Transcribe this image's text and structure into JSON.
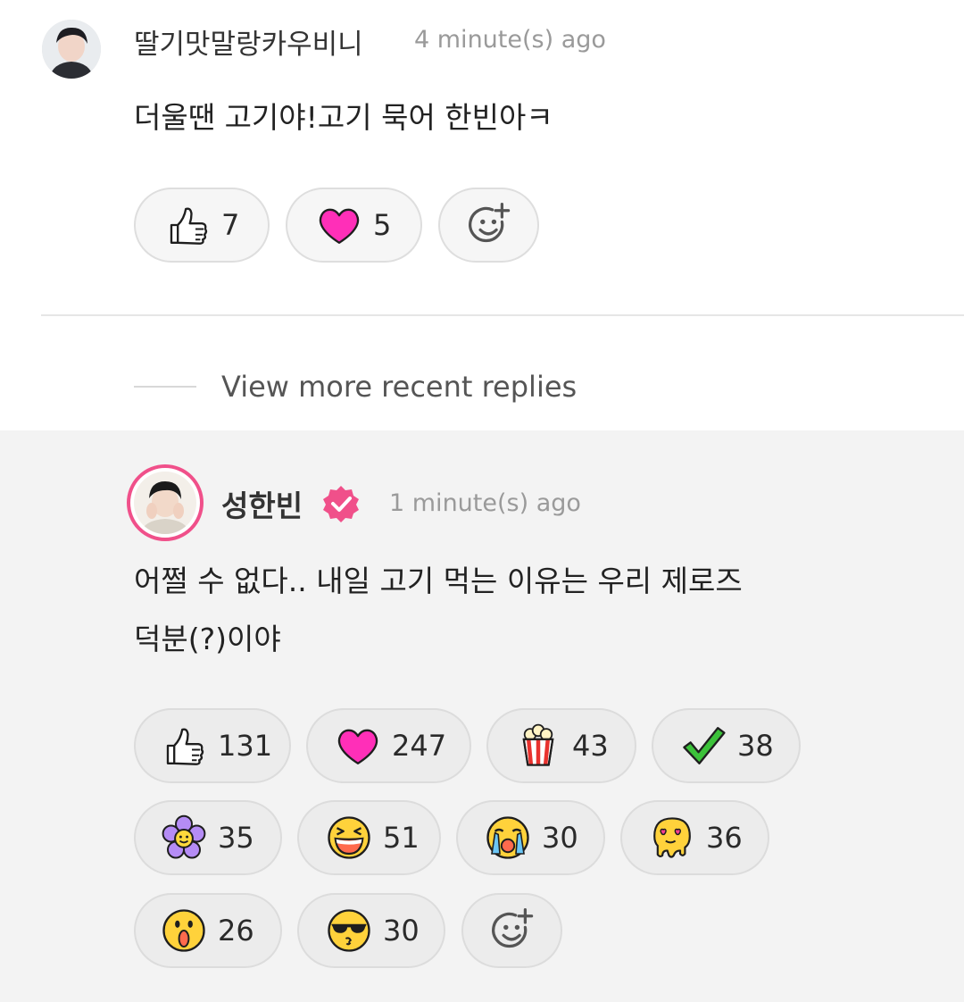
{
  "comment": {
    "username": "딸기맛말랑카우비니",
    "time": "4 minute(s) ago",
    "text": "더울땐 고기야!고기 묵어 한빈아ㅋ",
    "reactions": [
      {
        "icon": "thumbs-up-icon",
        "count": "7"
      },
      {
        "icon": "heart-icon",
        "count": "5"
      }
    ]
  },
  "thread": {
    "view_more_label": "View more recent replies"
  },
  "reply": {
    "username": "성한빈",
    "verified": true,
    "time": "1 minute(s) ago",
    "text_line1": "어쩔 수 없다.. 내일 고기 먹는 이유는 우리 제로즈",
    "text_line2": "덕분(?)이야",
    "reactions": [
      {
        "icon": "thumbs-up-icon",
        "count": "131"
      },
      {
        "icon": "heart-icon",
        "count": "247"
      },
      {
        "icon": "popcorn-icon",
        "count": "43"
      },
      {
        "icon": "checkmark-icon",
        "count": "38"
      },
      {
        "icon": "flower-icon",
        "count": "35"
      },
      {
        "icon": "laughing-face-icon",
        "count": "51"
      },
      {
        "icon": "crying-face-icon",
        "count": "30"
      },
      {
        "icon": "melting-heart-eyes-icon",
        "count": "36"
      },
      {
        "icon": "surprised-face-icon",
        "count": "26"
      },
      {
        "icon": "sunglasses-face-icon",
        "count": "30"
      }
    ]
  },
  "colors": {
    "accent_pink": "#f0508a",
    "heart": "#ff2fb8",
    "reply_bg": "#f3f3f3"
  }
}
